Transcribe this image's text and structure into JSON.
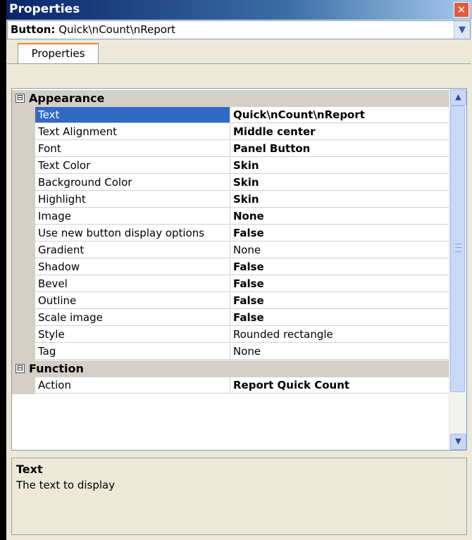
{
  "window": {
    "title": "Properties",
    "close_symbol": "✕"
  },
  "selector": {
    "label_bold": "Button:",
    "label_value": "Quick\\nCount\\nReport"
  },
  "tabs": [
    {
      "label": "Properties"
    }
  ],
  "grid": {
    "categories": [
      {
        "name": "Appearance",
        "toggle": "⊟"
      },
      {
        "name": "Function",
        "toggle": "⊟"
      }
    ],
    "appearance": [
      {
        "name": "Text",
        "value": "Quick\\nCount\\nReport"
      },
      {
        "name": "Text Alignment",
        "value": "Middle center"
      },
      {
        "name": "Font",
        "value": "Panel Button"
      },
      {
        "name": "Text Color",
        "value": "Skin"
      },
      {
        "name": "Background Color",
        "value": "Skin"
      },
      {
        "name": "Highlight",
        "value": "Skin"
      },
      {
        "name": "Image",
        "value": "None"
      },
      {
        "name": "Use new button display options",
        "value": "False"
      },
      {
        "name": "Gradient",
        "value": "None"
      },
      {
        "name": "Shadow",
        "value": "False"
      },
      {
        "name": "Bevel",
        "value": "False"
      },
      {
        "name": "Outline",
        "value": "False"
      },
      {
        "name": "Scale image",
        "value": "False"
      },
      {
        "name": "Style",
        "value": "Rounded rectangle"
      },
      {
        "name": "Tag",
        "value": "None"
      }
    ],
    "function": [
      {
        "name": "Action",
        "value": "Report Quick Count"
      }
    ]
  },
  "help": {
    "title": "Text",
    "description": "The text to display"
  },
  "icons": {
    "scroll_up": "chevron-up-icon",
    "scroll_down": "chevron-down-icon"
  },
  "colors": {
    "title_bar": "#0a246a",
    "selection": "#316ac5",
    "category_bg": "#d4d0c8"
  }
}
